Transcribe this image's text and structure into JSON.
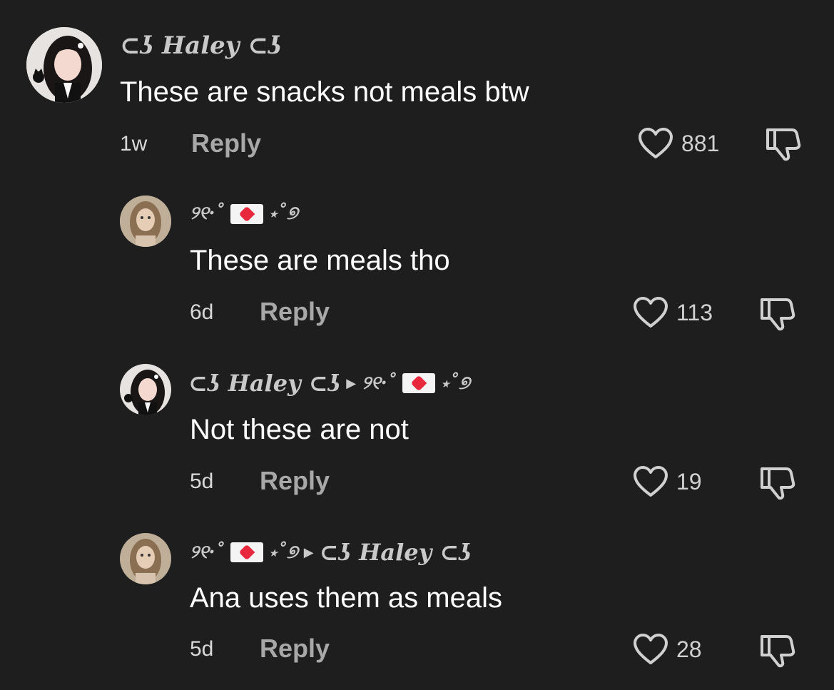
{
  "comments": [
    {
      "author": "⊂ʖ Haley ⊂ʖ",
      "reply_to": "",
      "text": "These are snacks not meals btw",
      "time": "1w",
      "reply_label": "Reply",
      "likes": "881"
    },
    {
      "author": "୨୧·˚",
      "author_suffix": "⋆˚୭",
      "reply_to": "",
      "text": "These are meals tho",
      "time": "6d",
      "reply_label": "Reply",
      "likes": "113"
    },
    {
      "author": "⊂ʖ Haley ⊂ʖ",
      "reply_to": "୨୧·˚",
      "reply_to_suffix": "⋆˚୭",
      "text": "Not these are not",
      "time": "5d",
      "reply_label": "Reply",
      "likes": "19"
    },
    {
      "author": "୨୧·˚",
      "author_suffix": "⋆˚୭",
      "reply_to": "⊂ʖ Haley ⊂ʖ",
      "text": "Ana uses them as meals",
      "time": "5d",
      "reply_label": "Reply",
      "likes": "28"
    }
  ],
  "icons": {
    "like": "heart-outline-icon",
    "dislike": "thumbs-down-icon",
    "reply_arrow": "play-arrow-icon",
    "envelope": "love-letter-icon"
  },
  "colors": {
    "background": "#1e1e1e",
    "text": "#ffffff",
    "muted": "#a8a8a8",
    "heart_envelope": "#e8283c"
  }
}
